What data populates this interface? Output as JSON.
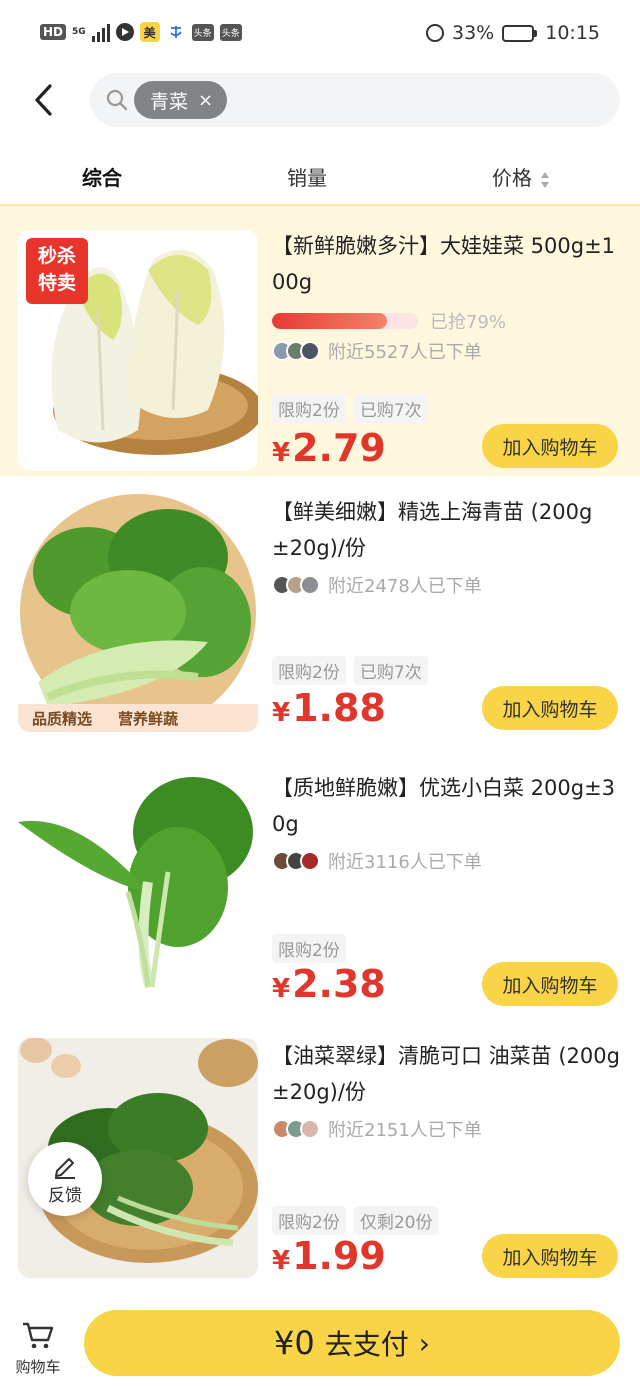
{
  "status_bar": {
    "hd": "HD",
    "net": "5G",
    "app_mt": "美",
    "news1": "头条",
    "news2": "头条",
    "battery": "33%",
    "battery_level": 0.33,
    "time": "10:15"
  },
  "search": {
    "chip_text": "青菜",
    "chip_close": "×"
  },
  "tabs": [
    {
      "label": "综合",
      "active": true
    },
    {
      "label": "销量",
      "active": false
    },
    {
      "label": "价格",
      "active": false
    }
  ],
  "products": [
    {
      "title": "【新鲜脆嫩多汁】大娃娃菜 500g±100g",
      "badge": [
        "秒杀",
        "特卖"
      ],
      "progress_text": "已抢79%",
      "progress_level": 0.79,
      "buyers_text": "附近5527人已下单",
      "tags": [
        "限购2份",
        "已购7次"
      ],
      "currency": "¥",
      "price": "2.79",
      "cart_label": "加入购物车"
    },
    {
      "title": "【鲜美细嫩】精选上海青苗 (200g±20g)/份",
      "strip": [
        "品质精选",
        "营养鲜蔬"
      ],
      "buyers_text": "附近2478人已下单",
      "tags": [
        "限购2份",
        "已购7次"
      ],
      "currency": "¥",
      "price": "1.88",
      "cart_label": "加入购物车"
    },
    {
      "title": "【质地鲜脆嫩】优选小白菜 200g±30g",
      "buyers_text": "附近3116人已下单",
      "tags": [
        "限购2份"
      ],
      "currency": "¥",
      "price": "2.38",
      "cart_label": "加入购物车"
    },
    {
      "title": "【油菜翠绿】清脆可口 油菜苗 (200g±20g)/份",
      "buyers_text": "附近2151人已下单",
      "tags": [
        "限购2份",
        "仅剩20份"
      ],
      "currency": "¥",
      "price": "1.99",
      "cart_label": "加入购物车"
    }
  ],
  "feedback": {
    "label": "反馈"
  },
  "bottom_bar": {
    "cart_label": "购物车",
    "pay_amount": "¥0",
    "pay_label": "去支付",
    "pay_arrow": "›"
  },
  "colors": {
    "accent_yellow": "#f8d446",
    "price_red": "#e0362c",
    "highlight_bg": "#fff8df"
  }
}
